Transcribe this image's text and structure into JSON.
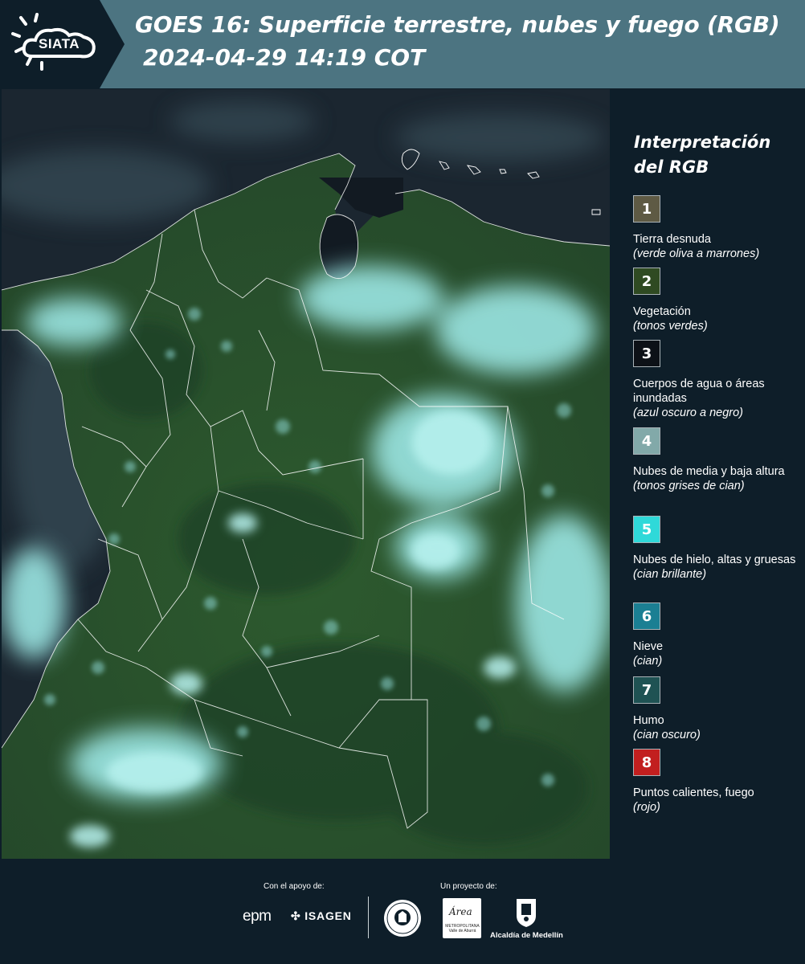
{
  "header": {
    "logo_text": "SIATA",
    "title": "GOES 16: Superficie terrestre, nubes y fuego (RGB)",
    "subtitle": "2024-04-29 14:19 COT",
    "colors": {
      "header_bg": "#4c7481",
      "logo_bg": "#0e1e29"
    }
  },
  "map": {
    "icon": "satellite-map-image",
    "colors": {
      "ocean": "#1b2630",
      "land": "#2d5a2e",
      "cloud": "#7fd6d6",
      "border": "#ffffff"
    }
  },
  "legend": {
    "title": "Interpretación del RGB",
    "items": [
      {
        "number": "1",
        "label": "Tierra desnuda",
        "note": "(verde oliva a marrones)",
        "color": "#5e5a44"
      },
      {
        "number": "2",
        "label": "Vegetación",
        "note": "(tonos verdes)",
        "color": "#2f4a22"
      },
      {
        "number": "3",
        "label": "Cuerpos de agua o áreas inundadas",
        "note": "(azul oscuro a negro)",
        "color": "#0d1117"
      },
      {
        "number": "4",
        "label": "Nubes de media y baja altura",
        "note": "(tonos grises de cian)",
        "color": "#82a9a9"
      },
      {
        "number": "5",
        "label": "Nubes de hielo, altas y gruesas",
        "note": "(cian brillante)",
        "color": "#2fd9d9"
      },
      {
        "number": "6",
        "label": "Nieve",
        "note": "(cian)",
        "color": "#1b7f93"
      },
      {
        "number": "7",
        "label": "Humo",
        "note": "(cian oscuro)",
        "color": "#1f5253"
      },
      {
        "number": "8",
        "label": "Puntos calientes, fuego",
        "note": "(rojo)",
        "color": "#c21f1f"
      }
    ]
  },
  "footer": {
    "support_label": "Con el apoyo de:",
    "project_label": "Un proyecto de:",
    "sponsor_1": "epm",
    "sponsor_2": "ISAGEN",
    "partner_area_word": "Área",
    "partner_area_sub": "METROPOLITANA Valle de Aburrá",
    "partner_alcaldia": "Alcaldía de Medellín"
  }
}
